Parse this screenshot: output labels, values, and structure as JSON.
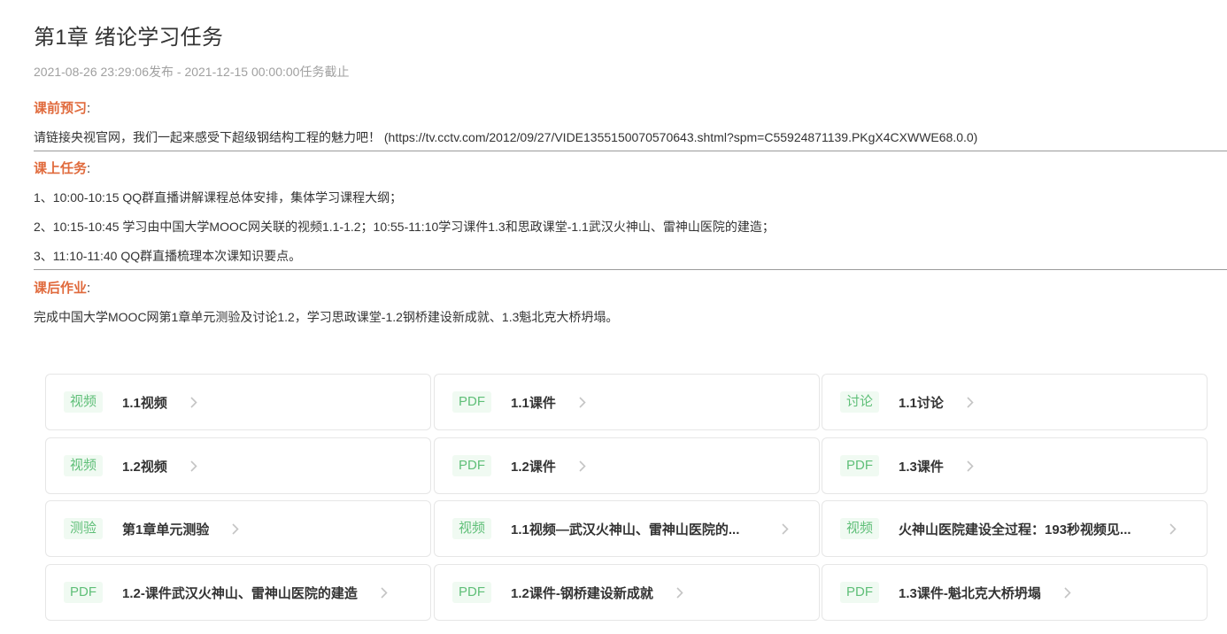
{
  "header": {
    "title": "第1章 绪论学习任务",
    "meta": "2021-08-26 23:29:06发布 - 2021-12-15 00:00:00任务截止"
  },
  "sections": {
    "preview": {
      "heading": "课前预习",
      "colon": ":",
      "lines": [
        "请链接央视官网，我们一起来感受下超级钢结构工程的魅力吧！ (https://tv.cctv.com/2012/09/27/VIDE1355150070570643.shtml?spm=C55924871139.PKgX4CXWWE68.0.0)"
      ]
    },
    "inclass": {
      "heading": "课上任务",
      "colon": ":",
      "lines": [
        "1、10:00-10:15 QQ群直播讲解课程总体安排，集体学习课程大纲；",
        "2、10:15-10:45 学习由中国大学MOOC网关联的视频1.1-1.2；10:55-11:10学习课件1.3和思政课堂-1.1武汉火神山、雷神山医院的建造；",
        "3、11:10-11:40 QQ群直播梳理本次课知识要点。"
      ]
    },
    "homework": {
      "heading": "课后作业",
      "colon": ":",
      "lines": [
        "完成中国大学MOOC网第1章单元测验及讨论1.2，学习思政课堂-1.2钢桥建设新成就、1.3魁北克大桥坍塌。"
      ]
    }
  },
  "resources": [
    {
      "tag": "视频",
      "title": "1.1视频"
    },
    {
      "tag": "PDF",
      "title": "1.1课件"
    },
    {
      "tag": "讨论",
      "title": "1.1讨论"
    },
    {
      "tag": "视频",
      "title": "1.2视频"
    },
    {
      "tag": "PDF",
      "title": "1.2课件"
    },
    {
      "tag": "PDF",
      "title": "1.3课件"
    },
    {
      "tag": "测验",
      "title": "第1章单元测验"
    },
    {
      "tag": "视频",
      "title": "1.1视频—武汉火神山、雷神山医院的..."
    },
    {
      "tag": "视频",
      "title": "火神山医院建设全过程：193秒视频见..."
    },
    {
      "tag": "PDF",
      "title": "1.2-课件武汉火神山、雷神山医院的建造"
    },
    {
      "tag": "PDF",
      "title": "1.2课件-钢桥建设新成就"
    },
    {
      "tag": "PDF",
      "title": "1.3课件-魁北克大桥坍塌"
    }
  ],
  "icons": {
    "chevron": "chevron-right-icon"
  },
  "colors": {
    "section_heading": "#e06a3c",
    "tag_text": "#5fbf78",
    "tag_bg": "#f0faf2"
  }
}
